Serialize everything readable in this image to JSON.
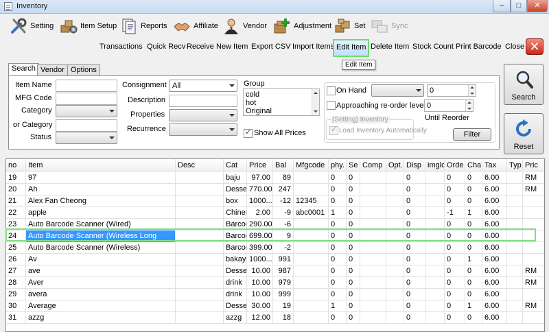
{
  "window": {
    "title": "Inventory",
    "min": "–",
    "max": "□",
    "close": "✕"
  },
  "toolbar": [
    {
      "label": "Setting",
      "icon": "setting-icon"
    },
    {
      "label": "Item Setup",
      "icon": "item-setup-icon"
    },
    {
      "label": "Reports",
      "icon": "reports-icon"
    },
    {
      "label": "Affiliate",
      "icon": "affiliate-icon"
    },
    {
      "label": "Vendor",
      "icon": "vendor-icon"
    },
    {
      "label": "Adjustment",
      "icon": "adjustment-icon"
    },
    {
      "label": "Set",
      "icon": "set-icon"
    },
    {
      "label": "Sync",
      "icon": "sync-icon",
      "disabled": true
    }
  ],
  "actions": [
    "Transactions",
    "Quick Recv",
    "Receive",
    "New Item",
    "Export CSV",
    "Import Items",
    "Edit Item",
    "Delete Item",
    "Stock Count",
    "Print Barcode",
    "Close"
  ],
  "close_icon": "✕",
  "tooltip": "Edit Item",
  "tabs": [
    "Search",
    "Vendor",
    "Options"
  ],
  "search": {
    "item_name": "Item Name",
    "mfg_code": "MFG Code",
    "category": "Category",
    "or_category": "or Category",
    "status": "Status",
    "consignment": "Consignment",
    "consignment_value": "All",
    "description": "Description",
    "properties": "Properties",
    "recurrence": "Recurrence",
    "group_label": "Group",
    "group_items": [
      "cold",
      "hot",
      "Original"
    ],
    "show_all_prices": "Show All Prices",
    "on_hand": "On Hand",
    "on_hand_value": "0",
    "approaching": "Approaching re-order level",
    "approaching_value": "0",
    "until_reorder": "Until Reorder",
    "setting_inventory": "(Setting) Inventory",
    "load_auto": "Load Inventory Automatically",
    "filter": "Filter",
    "search_btn": "Search",
    "reset_btn": "Reset"
  },
  "grid": {
    "columns": [
      "no",
      "Item",
      "Desc",
      "Cat",
      "Price",
      "Bal",
      "Mfgcode",
      "phy.",
      "Se",
      "Comp",
      "Opt.",
      "Disp",
      "imglc",
      "Orde",
      "Cha",
      "Tax",
      "Typ",
      "Pric"
    ],
    "rows": [
      {
        "no": "19",
        "item": "97",
        "desc": "",
        "cat": "baju",
        "price": "97.00",
        "bal": "89",
        "mfg": "",
        "phy": "0",
        "se": "0",
        "comp": "",
        "opt": "",
        "disp": "0",
        "img": "",
        "orde": "0",
        "cha": "0",
        "tax": "6.00",
        "typ": "",
        "pric": "RM"
      },
      {
        "no": "20",
        "item": "Ah",
        "desc": "",
        "cat": "Desse",
        "price": "770.00",
        "bal": "247",
        "mfg": "",
        "phy": "0",
        "se": "0",
        "comp": "",
        "opt": "",
        "disp": "0",
        "img": "",
        "orde": "0",
        "cha": "0",
        "tax": "6.00",
        "typ": "",
        "pric": "RM"
      },
      {
        "no": "21",
        "item": "Alex Fan Cheong",
        "desc": "",
        "cat": "box",
        "price": "1000...",
        "bal": "-12",
        "mfg": "12345",
        "phy": "0",
        "se": "0",
        "comp": "",
        "opt": "",
        "disp": "0",
        "img": "",
        "orde": "0",
        "cha": "0",
        "tax": "6.00",
        "typ": "",
        "pric": ""
      },
      {
        "no": "22",
        "item": "apple",
        "desc": "",
        "cat": "Chines",
        "price": "2.00",
        "bal": "-9",
        "mfg": "abc0001",
        "phy": "1",
        "se": "0",
        "comp": "",
        "opt": "",
        "disp": "0",
        "img": "",
        "orde": "-1",
        "cha": "1",
        "tax": "6.00",
        "typ": "",
        "pric": ""
      },
      {
        "no": "23",
        "item": "Auto Barcode Scanner (Wired)",
        "desc": "",
        "cat": "Barcoc",
        "price": "290.00",
        "bal": "-6",
        "mfg": "",
        "phy": "0",
        "se": "0",
        "comp": "",
        "opt": "",
        "disp": "0",
        "img": "",
        "orde": "0",
        "cha": "0",
        "tax": "6.00",
        "typ": "",
        "pric": ""
      },
      {
        "no": "24",
        "item": "Auto Barcode Scanner (Wireless Long",
        "desc": "",
        "cat": "Barcoc",
        "price": "699.00",
        "bal": "9",
        "mfg": "",
        "phy": "0",
        "se": "0",
        "comp": "",
        "opt": "",
        "disp": "0",
        "img": "",
        "orde": "0",
        "cha": "0",
        "tax": "6.00",
        "typ": "",
        "pric": "",
        "selected": true
      },
      {
        "no": "25",
        "item": "Auto Barcode Scanner (Wireless)",
        "desc": "",
        "cat": "Barcoc",
        "price": "399.00",
        "bal": "-2",
        "mfg": "",
        "phy": "0",
        "se": "0",
        "comp": "",
        "opt": "",
        "disp": "0",
        "img": "",
        "orde": "0",
        "cha": "0",
        "tax": "6.00",
        "typ": "",
        "pric": ""
      },
      {
        "no": "26",
        "item": "Av",
        "desc": "",
        "cat": "bakaye",
        "price": "1000...",
        "bal": "991",
        "mfg": "",
        "phy": "0",
        "se": "0",
        "comp": "",
        "opt": "",
        "disp": "0",
        "img": "",
        "orde": "0",
        "cha": "1",
        "tax": "6.00",
        "typ": "",
        "pric": ""
      },
      {
        "no": "27",
        "item": "ave",
        "desc": "",
        "cat": "Desse",
        "price": "10.00",
        "bal": "987",
        "mfg": "",
        "phy": "0",
        "se": "0",
        "comp": "",
        "opt": "",
        "disp": "0",
        "img": "",
        "orde": "0",
        "cha": "0",
        "tax": "6.00",
        "typ": "",
        "pric": "RM"
      },
      {
        "no": "28",
        "item": "Aver",
        "desc": "",
        "cat": "drink",
        "price": "10.00",
        "bal": "979",
        "mfg": "",
        "phy": "0",
        "se": "0",
        "comp": "",
        "opt": "",
        "disp": "0",
        "img": "",
        "orde": "0",
        "cha": "0",
        "tax": "6.00",
        "typ": "",
        "pric": "RM"
      },
      {
        "no": "29",
        "item": "avera",
        "desc": "",
        "cat": "drink",
        "price": "10.00",
        "bal": "999",
        "mfg": "",
        "phy": "0",
        "se": "0",
        "comp": "",
        "opt": "",
        "disp": "0",
        "img": "",
        "orde": "0",
        "cha": "0",
        "tax": "6.00",
        "typ": "",
        "pric": ""
      },
      {
        "no": "30",
        "item": "Average",
        "desc": "",
        "cat": "Desse",
        "price": "30.00",
        "bal": "19",
        "mfg": "",
        "phy": "1",
        "se": "0",
        "comp": "",
        "opt": "",
        "disp": "0",
        "img": "",
        "orde": "0",
        "cha": "1",
        "tax": "6.00",
        "typ": "",
        "pric": "RM"
      },
      {
        "no": "31",
        "item": "azzg",
        "desc": "",
        "cat": "azzg",
        "price": "12.00",
        "bal": "18",
        "mfg": "",
        "phy": "0",
        "se": "0",
        "comp": "",
        "opt": "",
        "disp": "0",
        "img": "",
        "orde": "0",
        "cha": "0",
        "tax": "6.00",
        "typ": "",
        "pric": ""
      }
    ]
  }
}
